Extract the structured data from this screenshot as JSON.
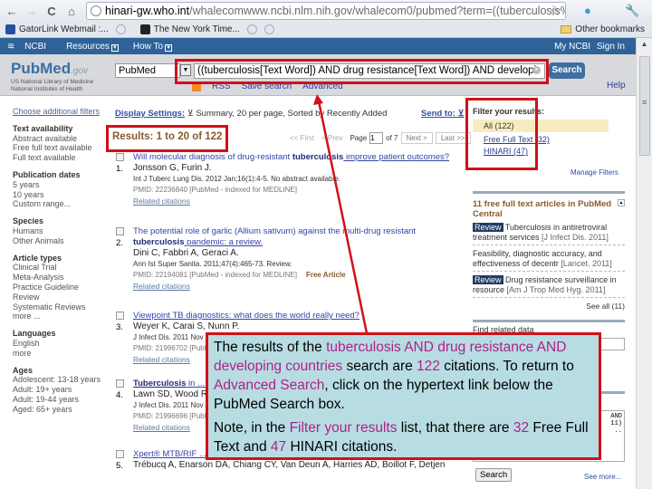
{
  "browser": {
    "nav_back": "←",
    "nav_forward": "→",
    "nav_reload": "C",
    "nav_home": "⌂",
    "url_host": "hinari-gw.who.int",
    "url_path": "/whalecomwww.ncbi.nlm.nih.gov/whalecom0/pubmed?term=((tuberculosis%5BText",
    "bookmarks": [
      {
        "label": "GatorLink Webmail :..."
      },
      {
        "label": "The New York Time..."
      }
    ],
    "other_bookmarks": "Other bookmarks"
  },
  "ncbi_bar": {
    "logo": "NCBI",
    "resources": "Resources",
    "how_to": "How To",
    "my_ncbi": "My NCBI",
    "sign_in": "Sign In"
  },
  "search": {
    "logo_main": "PubMed",
    "logo_suffix": ".gov",
    "logo_sub1": "US National Library of Medicine",
    "logo_sub2": "National Institutes of Health",
    "database": "PubMed",
    "query": "((tuberculosis[Text Word]) AND drug resistance[Text Word]) AND developi",
    "search_button": "Search",
    "rss": "RSS",
    "save_search": "Save search",
    "advanced": "Advanced",
    "help": "Help"
  },
  "left_filters": {
    "choose": "Choose additional filters",
    "groups": [
      {
        "head": "Text availability",
        "items": [
          "Abstract available",
          "Free full text available",
          "Full text available"
        ]
      },
      {
        "head": "Publication dates",
        "items": [
          "5 years",
          "10 years",
          "Custom range..."
        ]
      },
      {
        "head": "Species",
        "items": [
          "Humans",
          "Other Animals"
        ]
      },
      {
        "head": "Article types",
        "items": [
          "Clinical Trial",
          "Meta-Analysis",
          "Practice Guideline",
          "Review",
          "Systematic Reviews",
          "more ..."
        ]
      },
      {
        "head": "Languages",
        "items": [
          "English",
          "more"
        ]
      },
      {
        "head": "Ages",
        "items": [
          "Adolescent: 13-18 years",
          "Adult: 19+ years",
          "Adult: 19-44 years",
          "Aged: 65+ years"
        ]
      }
    ]
  },
  "results": {
    "display_settings_label": "Display Settings:",
    "display_settings_value": "Summary, 20 per page, Sorted by Recently Added",
    "send_to": "Send to:",
    "count_text": "Results: 1 to 20 of 122",
    "pager": {
      "first": "<< First",
      "prev": "< Prev",
      "page_label": "Page",
      "page_value": "1",
      "of": "of 7",
      "next": "Next >",
      "last": "Last >>"
    },
    "items": [
      {
        "num": "1.",
        "title_pre": "Will molecular diagnosis of drug-resistant ",
        "title_bold": "tuberculosis",
        "title_post": " improve patient outcomes?",
        "authors": "Jonsson G, Furin J.",
        "journal": "Int J Tuberc Lung Dis. 2012 Jan;16(1):4-5. No abstract available.",
        "pmid": "PMID: 22236840 [PubMed - indexed for MEDLINE]",
        "free": "",
        "related": "Related citations"
      },
      {
        "num": "2.",
        "title_pre": "The potential role of garlic (Allium sativum) against the multi-drug resistant ",
        "title_bold": "tuberculosis",
        "title_post": " pandemic: a review.",
        "authors": "Dini C, Fabbri A, Geraci A.",
        "journal": "Ann Ist Super Sanita. 2011;47(4):465-73. Review.",
        "pmid": "PMID: 22194081 [PubMed - indexed for MEDLINE]",
        "free": "Free Article",
        "related": "Related citations"
      },
      {
        "num": "3.",
        "title_pre": "Viewpoint TB diagnostics: what does the world really need?",
        "title_bold": "",
        "title_post": "",
        "authors": "Weyer K, Carai S, Nunn P.",
        "journal": "J Infect Dis. 2011 Nov",
        "pmid": "PMID: 21996702 [PubMed",
        "free": "",
        "related": "Related citations"
      },
      {
        "num": "4.",
        "title_pre": "",
        "title_bold": "Tuberculosis",
        "title_post": " in ... addressing the ch",
        "authors": "Lawn SD, Wood R",
        "journal": "J Infect Dis. 2011 Nov",
        "pmid": "PMID: 21996696 [PubMed",
        "free": "",
        "related": "Related citations"
      },
      {
        "num": "5.",
        "title_pre": "Xpert® MTB/RIF ... when, where and how?",
        "title_bold": "",
        "title_post": "",
        "authors": "Trébucq A, Enarson DA, Chiang CY, Van Deun A, Harries AD, Boillot F, Detjen",
        "journal": "",
        "pmid": "",
        "free": "",
        "related": ""
      }
    ]
  },
  "right_sidebar": {
    "filter_head": "Filter your results:",
    "filter_all": "All (122)",
    "filter_free": "Free Full Text (32)",
    "filter_hinari": "HINARI (47)",
    "manage_filters": "Manage Filters",
    "pmc_head": "11 free full text articles in PubMed Central",
    "pmc_items": [
      {
        "tag": "Review",
        "text": "Tuberculosis in antiretroviral treatment services",
        "src": "[J Infect Dis. 2011]"
      },
      {
        "tag": "",
        "text": "Feasibility, diagnostic accuracy, and effectiveness of decentr",
        "src": "[Lancet. 2011]"
      },
      {
        "tag": "Review",
        "text": "Drug resistance surveillance in resource",
        "src": "[Am J Trop Med Hyg. 2011]"
      }
    ],
    "see_all": "See all (11)",
    "related_head": "Find related data",
    "history_text": "AND\n11)\n..",
    "search_button": "Search",
    "see_more": "See more..."
  },
  "callout": {
    "p1_a": "The results of the ",
    "p1_hl1": "tuberculosis AND drug resistance AND developing countries",
    "p1_b": " search are ",
    "p1_hl2": "122",
    "p1_c": " citations. To return to ",
    "p1_hl3": "Advanced Search",
    "p1_d": ", click on the hypertext link below the PubMed Search box.",
    "p2_a": "Note, in the ",
    "p2_hl1": "Filter your results",
    "p2_b": " list, that there are ",
    "p2_hl2": "32",
    "p2_c": " Free Full Text and ",
    "p2_hl3": "47",
    "p2_d": " HINARI citations.",
    "highlight_color": "#b0208a",
    "border_color": "#d21018"
  }
}
